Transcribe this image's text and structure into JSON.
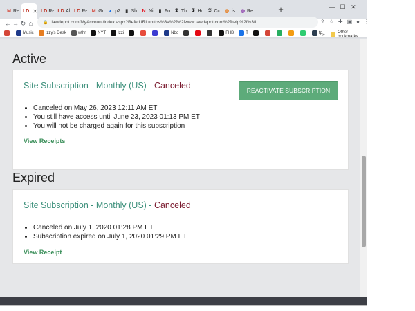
{
  "browser": {
    "tabs": [
      {
        "fav": "M",
        "label": "Re",
        "color": "#d44638"
      },
      {
        "fav": "LD",
        "label": "",
        "color": "#c0392b",
        "active": true
      },
      {
        "fav": "LD",
        "label": "Re",
        "color": "#c0392b"
      },
      {
        "fav": "LD",
        "label": "Al",
        "color": "#c0392b"
      },
      {
        "fav": "LD",
        "label": "Re",
        "color": "#c0392b"
      },
      {
        "fav": "M",
        "label": "Gr",
        "color": "#d44638"
      },
      {
        "fav": "▲",
        "label": "p2",
        "color": "#1a73e8"
      },
      {
        "fav": "▮",
        "label": "Sh",
        "color": "#333"
      },
      {
        "fav": "N",
        "label": "Ni",
        "color": "#e50914"
      },
      {
        "fav": "▮",
        "label": "Fo",
        "color": "#333"
      },
      {
        "fav": "𝕿",
        "label": "Th",
        "color": "#111"
      },
      {
        "fav": "𝕿",
        "label": "Hc",
        "color": "#111"
      },
      {
        "fav": "𝕿",
        "label": "Cc",
        "color": "#111"
      },
      {
        "fav": "◍",
        "label": "is",
        "color": "#e67e22"
      },
      {
        "fav": "◍",
        "label": "Re",
        "color": "#8e44ad"
      }
    ],
    "url": "lawdepot.com/MyAccount/index.aspx?ReferURL=https%3a%2f%2fwww.lawdepot.com%2fhelp%2f%3fl...",
    "new_tab_label": "+",
    "bookmarks": [
      {
        "label": "",
        "color": "#d44638"
      },
      {
        "label": "Music",
        "color": "#1e3a8a"
      },
      {
        "label": "Izzy's Desk",
        "color": "#e67e22"
      },
      {
        "label": "wthr",
        "color": "#555"
      },
      {
        "label": "NYT",
        "color": "#111"
      },
      {
        "label": "Izzi",
        "color": "#111"
      },
      {
        "label": "",
        "color": "#111"
      },
      {
        "label": "",
        "color": "#e74c3c"
      },
      {
        "label": "",
        "color": "#3b3bd1"
      },
      {
        "label": "Nbo",
        "color": "#1e3a8a"
      },
      {
        "label": "",
        "color": "#333"
      },
      {
        "label": "",
        "color": "#e50914"
      },
      {
        "label": "",
        "color": "#333"
      },
      {
        "label": "FHB",
        "color": "#111"
      },
      {
        "label": "T",
        "color": "#1a73e8"
      },
      {
        "label": "",
        "color": "#111"
      },
      {
        "label": "",
        "color": "#d44638"
      },
      {
        "label": "",
        "color": "#27ae60"
      },
      {
        "label": "",
        "color": "#f39c12"
      },
      {
        "label": "",
        "color": "#2ecc71"
      },
      {
        "label": "tp",
        "color": "#2c3e50"
      }
    ],
    "other_bookmarks": "Other bookmarks",
    "overflow": "»"
  },
  "page": {
    "active_heading": "Active",
    "expired_heading": "Expired",
    "active_card": {
      "title": "Site Subscription - Monthly (US) - ",
      "status": "Canceled",
      "button": "REACTIVATE SUBSCRIPTION",
      "items": [
        "Canceled on May 26, 2023 12:11 AM ET",
        "You still have access until June 23, 2023 01:13 PM ET",
        "You will not be charged again for this subscription"
      ],
      "link": "View Receipts"
    },
    "expired_card": {
      "title": "Site Subscription - Monthly (US) - ",
      "status": "Canceled",
      "items": [
        "Canceled on July 1, 2020 01:28 PM ET",
        "Subscription expired on July 1, 2020 01:29 PM ET"
      ],
      "link": "View Receipt"
    }
  },
  "colors": {
    "title_green": "#3b8f7a",
    "status_red": "#7a1a2e",
    "button_green": "#5dab7a",
    "link_green": "#3b8f5a"
  }
}
